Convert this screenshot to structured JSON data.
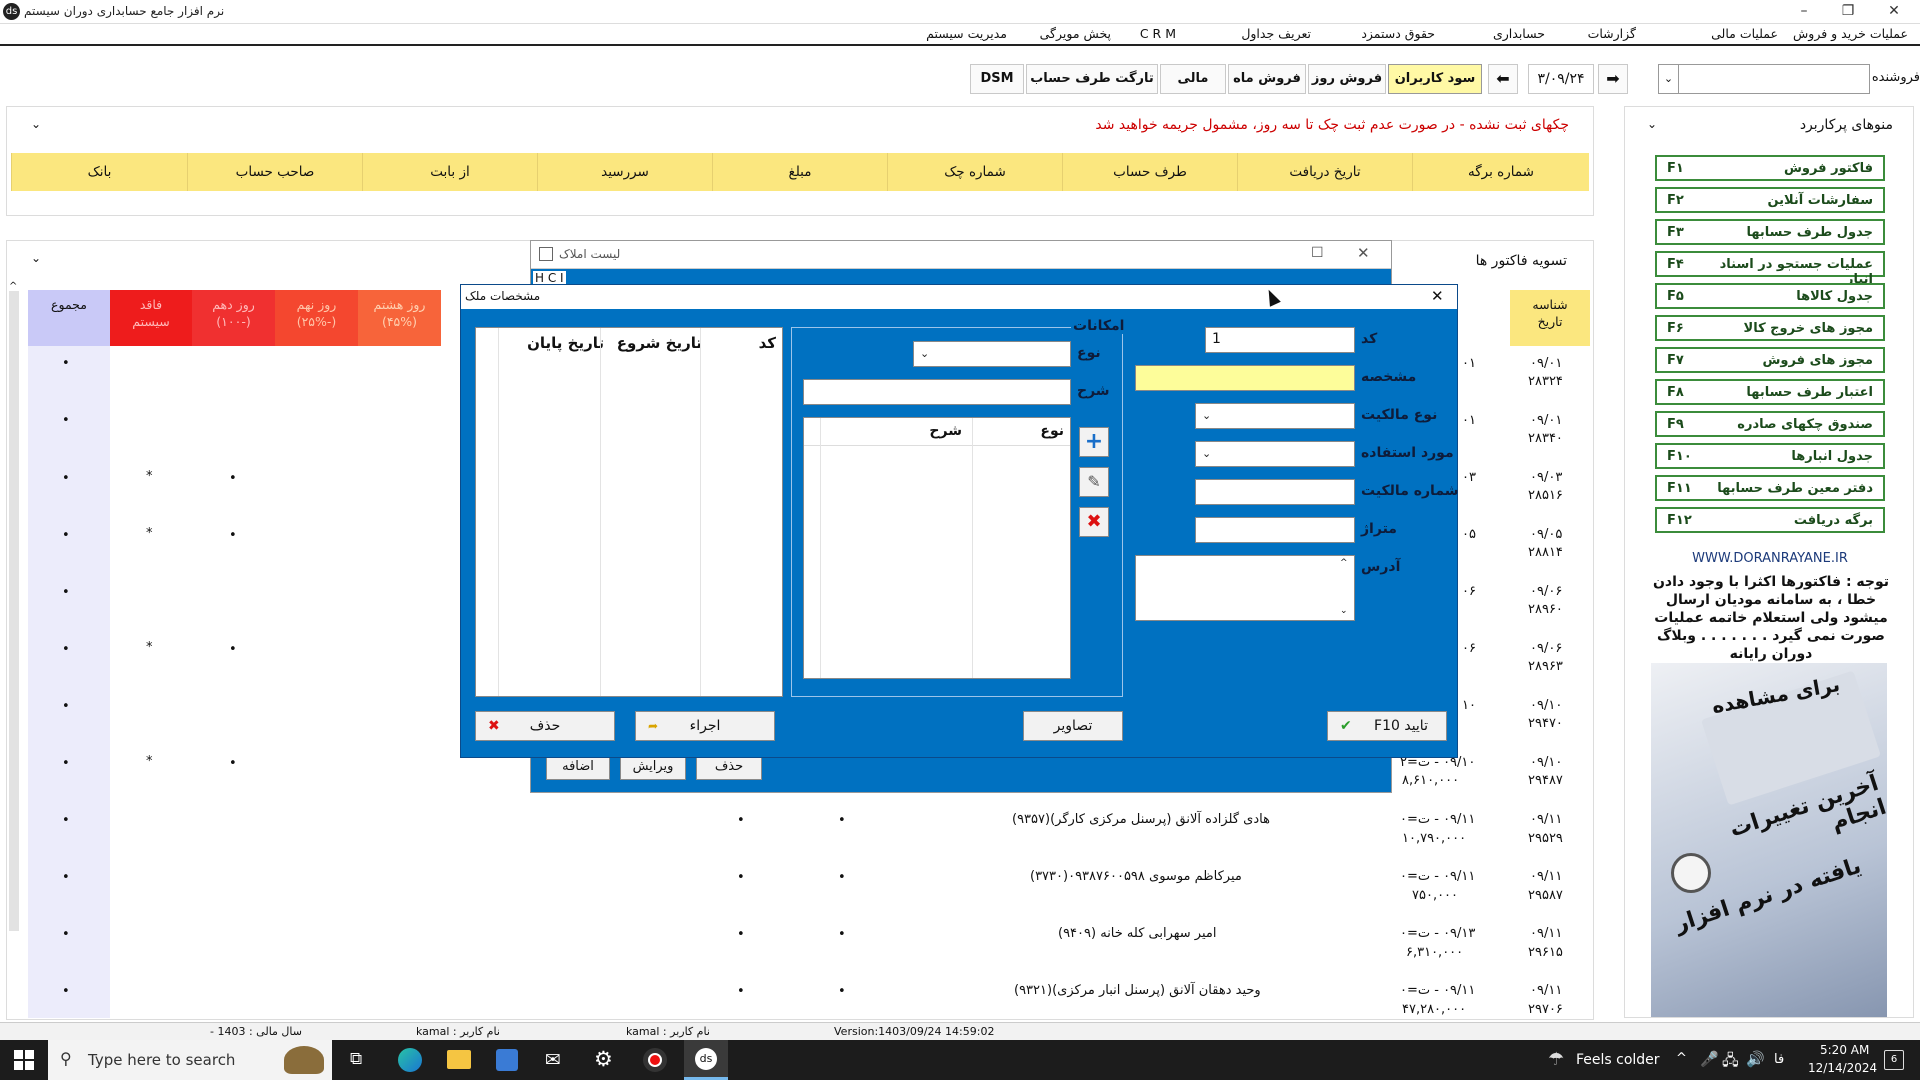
{
  "window": {
    "title": "نرم افزار جامع حسابداری دوران سیستم",
    "app_icon": "app-logo-icon"
  },
  "menu": [
    {
      "label": "عملیات خرید و فروش"
    },
    {
      "label": "عملیات مالی"
    },
    {
      "label": "گزارشات"
    },
    {
      "label": "حسابداری"
    },
    {
      "label": "حقوق دستمزد"
    },
    {
      "label": "تعریف جداول"
    },
    {
      "label": "C R M"
    },
    {
      "label": "پخش مویرگی"
    },
    {
      "label": "مدیریت سیستم"
    }
  ],
  "toolbar": {
    "seller_label": "فروشنده",
    "date": "۳/۰۹/۲۴",
    "buttons": [
      {
        "label": "سود کاربران",
        "active": true
      },
      {
        "label": "فروش روز"
      },
      {
        "label": "فروش ماه"
      },
      {
        "label": "مالی"
      },
      {
        "label": "تارگت طرف حساب"
      },
      {
        "label": "DSM"
      }
    ]
  },
  "cheque_panel": {
    "notice": "چکهای ثبت نشده - در صورت عدم ثبت چک تا سه روز، مشمول جریمه خواهید شد",
    "columns": [
      "شماره برگه",
      "تاریخ دریافت",
      "طرف حساب",
      "شماره چک",
      "مبلغ",
      "سررسید",
      "از بابت",
      "صاحب حساب",
      "بانک"
    ]
  },
  "invoice_panel": {
    "title": "تسویه فاکتور ها",
    "header_right": "شناسه\nتاریخ",
    "header_left": [
      "مجموع",
      "فاقد\nسیستم",
      "روز دهم\n(۱۰۰-)",
      "روز نهم\n(۲۵%-)",
      "روز هشتم\n(۴۵%)"
    ],
    "rows": [
      {
        "id": "۰۹/۰۱",
        "no": "۲۸۳۲۴",
        "col": "۰۱"
      },
      {
        "id": "۰۹/۰۱",
        "no": "۲۸۳۴۰",
        "col": "۰۱"
      },
      {
        "id": "۰۹/۰۳",
        "no": "۲۸۵۱۶",
        "col": "۰۳"
      },
      {
        "id": "۰۹/۰۵",
        "no": "۲۸۸۱۴",
        "col": "۰۵"
      },
      {
        "id": "۰۹/۰۶",
        "no": "۲۸۹۶۰",
        "col": "۰۶"
      },
      {
        "id": "۰۹/۰۶",
        "no": "۲۸۹۶۳",
        "col": "۰۶"
      },
      {
        "id": "۰۹/۱۰",
        "no": "۲۹۴۷۰",
        "col": "۱۰"
      },
      {
        "id": "۰۹/۱۰",
        "no": "۲۹۴۸۷",
        "col": "۰۹/۱۰ - ت=۲",
        "amount": "۸,۶۱۰,۰۰۰"
      },
      {
        "id": "۰۹/۱۱",
        "no": "۲۹۵۲۹",
        "col": "۰۹/۱۱ - ت=۰",
        "amount": "۱۰,۷۹۰,۰۰۰",
        "name": "هادی گلزاده آلانق (پرسنل مرکزی کارگر)(۹۳۵۷)"
      },
      {
        "id": "۰۹/۱۱",
        "no": "۲۹۵۸۷",
        "col": "۰۹/۱۱ - ت=۰",
        "amount": "۷۵۰,۰۰۰",
        "name": "میرکاظم موسوی ۰۹۳۸۷۶۰۰۵۹۸(۳۷۳۰)"
      },
      {
        "id": "۰۹/۱۱",
        "no": "۲۹۶۱۵",
        "col": "۰۹/۱۳ - ت=۰",
        "amount": "۶,۳۱۰,۰۰۰",
        "name": "امیر سهرابی کله خانه (۹۴۰۹)"
      },
      {
        "id": "۰۹/۱۱",
        "no": "۲۹۷۰۶",
        "col": "۰۹/۱۱ - ت=۰",
        "amount": "۴۷,۲۸۰,۰۰۰",
        "name": "وحید دهقان آلانق (پرسنل انبار مرکزی)(۹۳۲۱)"
      }
    ],
    "dot": "•",
    "star": "*"
  },
  "sidebar": {
    "title": "منوهای پرکاربرد",
    "items": [
      {
        "label": "فاکتور فروش",
        "key": "F۱"
      },
      {
        "label": "سفارشات آنلاین",
        "key": "F۲"
      },
      {
        "label": "جدول طرف حسابها",
        "key": "F۳"
      },
      {
        "label": "عملیات جستجو در اسناد انبار",
        "key": "F۴"
      },
      {
        "label": "جدول کالاها",
        "key": "F۵"
      },
      {
        "label": "مجوز های خروج کالا",
        "key": "F۶"
      },
      {
        "label": "مجوز های فروش",
        "key": "F۷"
      },
      {
        "label": "اعتبار طرف حسابها",
        "key": "F۸"
      },
      {
        "label": "صندوق چکهای صادره",
        "key": "F۹"
      },
      {
        "label": "جدول انبارها",
        "key": "F۱۰"
      },
      {
        "label": "دفتر معین طرف حسابها",
        "key": "F۱۱"
      },
      {
        "label": "برگه دریافت",
        "key": "F۱۲"
      }
    ],
    "website": "WWW.DORANRAYANE.IR",
    "note": "توجه : فاکتورها اکثرا با وجود دادن خطا ، به سامانه مودیان ارسال میشود ولی استعلام خاتمه عملیات صورت نمی گیرد . . . . . . . وبلاگ دوران رایانه",
    "banner_line1": "برای مشاهده",
    "banner_line2": "آخرین تغییرات انجام",
    "banner_line3": "یافته در نرم افزار"
  },
  "dialog_list": {
    "title": "لیست املاک",
    "strip": "H C I",
    "buttons": {
      "add": "اضافه",
      "edit": "ویرایش",
      "delete": "حذف"
    }
  },
  "dialog_spec": {
    "title": "مشخصات ملک",
    "fields": {
      "code_label": "کد",
      "code_value": "1",
      "spec_label": "مشخصه",
      "ownership_type_label": "نوع مالکیت",
      "usage_label": "مورد استفاده",
      "ownership_no_label": "شماره مالکیت",
      "area_label": "متراژ",
      "address_label": "آدرس"
    },
    "facilities": {
      "group_label": "امکانات",
      "type_label": "نوع",
      "desc_label": "شرح",
      "table_cols": [
        "نوع",
        "شرح"
      ]
    },
    "period_table_cols": [
      "کد",
      "تاریخ شروع",
      "تاریخ پایان"
    ],
    "buttons": {
      "confirm": "تایید F10",
      "images": "تصاویر",
      "execute": "اجراء",
      "delete": "حذف"
    }
  },
  "statusbar": {
    "version": "Version:1403/09/24 14:59:02",
    "user1": "نام کاربر : kamal",
    "user2": "نام کاربر : kamal",
    "fiscal_year": "سال مالی : 1403 -"
  },
  "taskbar": {
    "search_placeholder": "Type here to search",
    "weather": "Feels colder",
    "lang": "فا",
    "time": "5:20 AM",
    "date": "12/14/2024",
    "notif_count": "6"
  }
}
